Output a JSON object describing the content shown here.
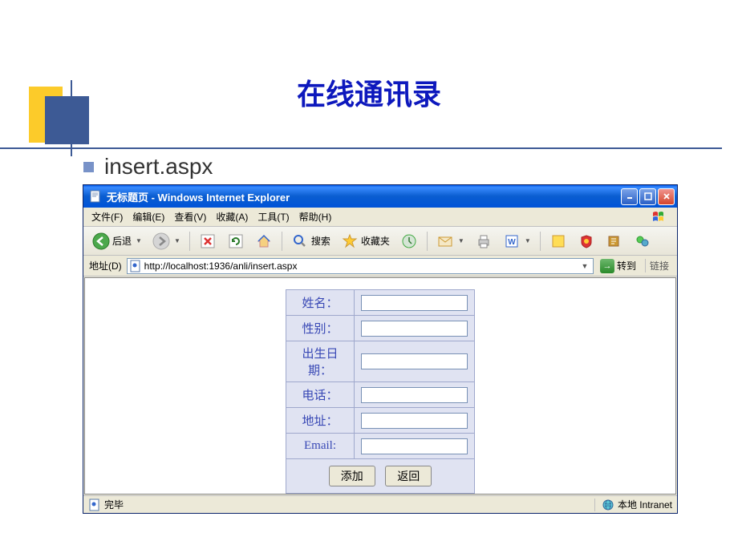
{
  "slide": {
    "title": "在线通讯录",
    "bullet_text": "insert.aspx"
  },
  "window": {
    "title": "无标题页 - Windows Internet Explorer",
    "menus": {
      "file": "文件(F)",
      "edit": "编辑(E)",
      "view": "查看(V)",
      "favorites": "收藏(A)",
      "tools": "工具(T)",
      "help": "帮助(H)"
    },
    "toolbar": {
      "back": "后退",
      "search": "搜索",
      "favorites": "收藏夹"
    },
    "addressbar": {
      "label": "地址(D)",
      "url": "http://localhost:1936/anli/insert.aspx",
      "go": "转到",
      "links": "链接"
    },
    "statusbar": {
      "done": "完毕",
      "zone": "本地 Intranet"
    }
  },
  "form": {
    "fields": {
      "name": "姓名：",
      "gender": "性别：",
      "birthdate": "出生日期：",
      "phone": "电话：",
      "address": "地址：",
      "email": "Email:"
    },
    "buttons": {
      "add": "添加",
      "back": "返回"
    }
  }
}
